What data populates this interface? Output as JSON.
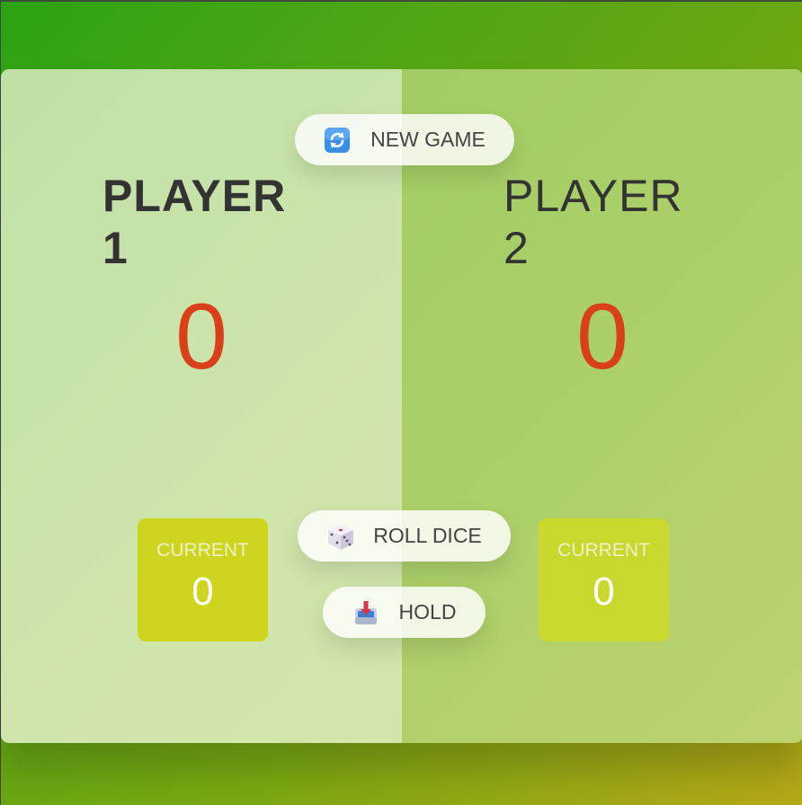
{
  "players": [
    {
      "name": "Player",
      "number": "1",
      "score": "0",
      "current_label": "Current",
      "current_score": "0",
      "active": true
    },
    {
      "name": "Player",
      "number": "2",
      "score": "0",
      "current_label": "Current",
      "current_score": "0",
      "active": false
    }
  ],
  "buttons": {
    "new_game": {
      "label": "New game",
      "icon": "refresh-icon"
    },
    "roll_dice": {
      "label": "Roll dice",
      "icon": "dice-icon"
    },
    "hold": {
      "label": "Hold",
      "icon": "inbox-tray-icon"
    }
  },
  "colors": {
    "score": "#d9401a",
    "current_box": "#cfd51f",
    "text": "#333333"
  }
}
